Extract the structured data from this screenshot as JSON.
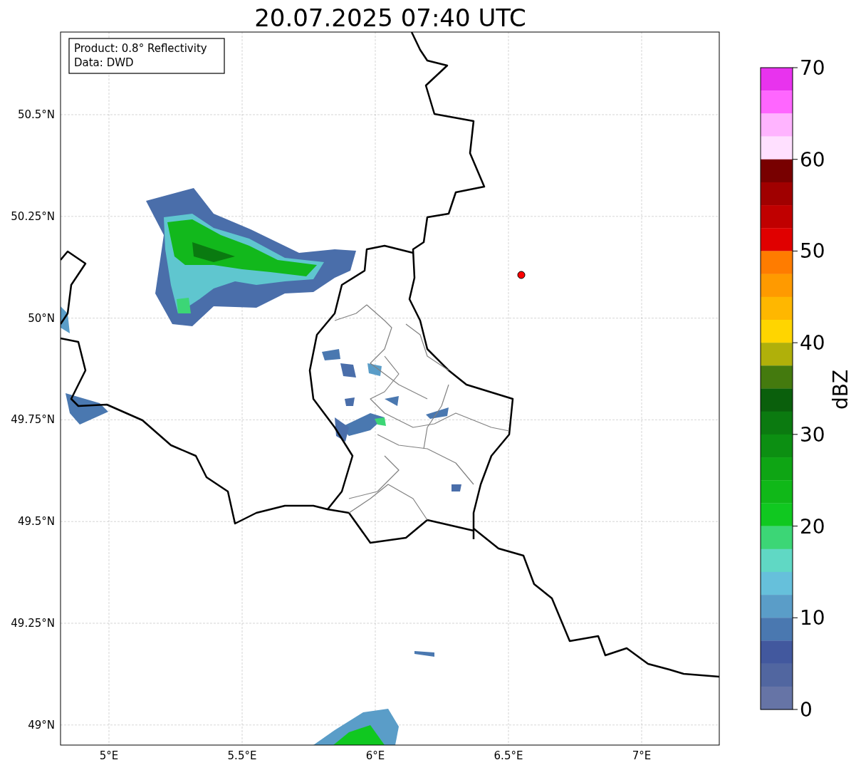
{
  "title": "20.07.2025 07:40 UTC",
  "info_box": {
    "lines": [
      "Product: 0.8° Reflectivity",
      "Data: DWD"
    ]
  },
  "map": {
    "xticks": [
      "5°E",
      "5.5°E",
      "6°E",
      "6.5°E",
      "7°E"
    ],
    "yticks": [
      "50.5°N",
      "50.25°N",
      "50°N",
      "49.75°N",
      "49.5°N",
      "49.25°N",
      "49°N"
    ]
  },
  "colorbar": {
    "label": "dBZ",
    "ticks": [
      "70",
      "60",
      "50",
      "40",
      "30",
      "20",
      "10",
      "0"
    ],
    "bins": [
      {
        "color": "#e833ee"
      },
      {
        "color": "#ff66ff"
      },
      {
        "color": "#ffb4ff"
      },
      {
        "color": "#ffe0ff"
      },
      {
        "color": "#780000"
      },
      {
        "color": "#a00000"
      },
      {
        "color": "#c00000"
      },
      {
        "color": "#e00000"
      },
      {
        "color": "#ff7c00"
      },
      {
        "color": "#ff9a00"
      },
      {
        "color": "#ffb700"
      },
      {
        "color": "#ffd500"
      },
      {
        "color": "#b0b00a"
      },
      {
        "color": "#447a0e"
      },
      {
        "color": "#0a5f0c"
      },
      {
        "color": "#0b7a10"
      },
      {
        "color": "#0c8f12"
      },
      {
        "color": "#0ea514"
      },
      {
        "color": "#10b818"
      },
      {
        "color": "#10c820"
      },
      {
        "color": "#3cd676"
      },
      {
        "color": "#60d8c4"
      },
      {
        "color": "#66c0db"
      },
      {
        "color": "#5a9dc8"
      },
      {
        "color": "#4a78b0"
      },
      {
        "color": "#42589e"
      },
      {
        "color": "#5166a0"
      },
      {
        "color": "#6674a6"
      }
    ]
  }
}
